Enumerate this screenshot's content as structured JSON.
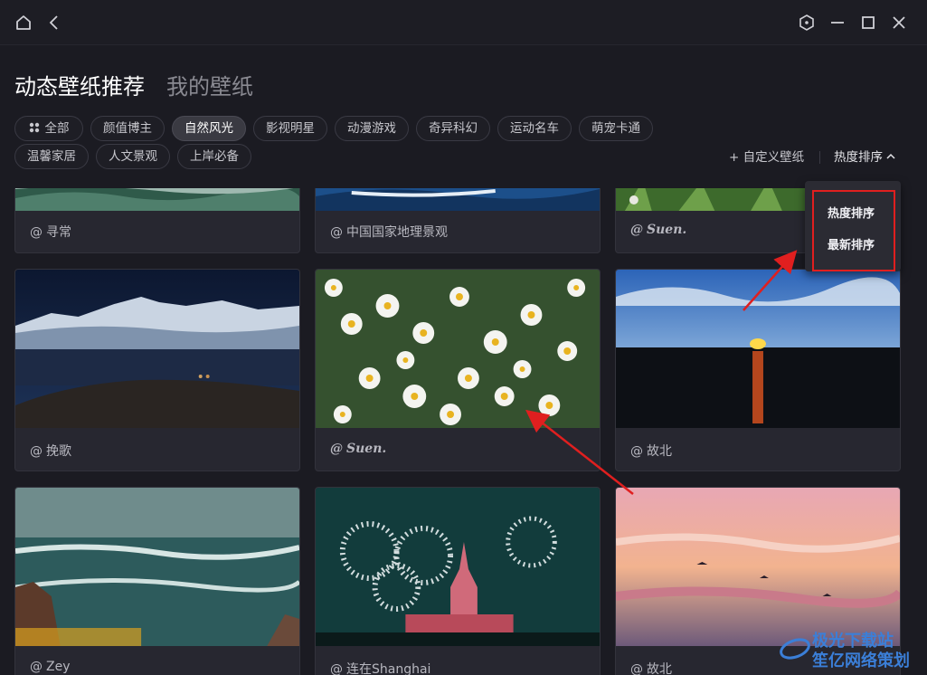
{
  "window": {
    "icons": [
      "home-icon",
      "back-icon",
      "shield-icon",
      "minimize-icon",
      "maximize-icon",
      "close-icon"
    ]
  },
  "header": {
    "tabs": [
      {
        "label": "动态壁纸推荐",
        "active": true
      },
      {
        "label": "我的壁纸",
        "active": false
      }
    ]
  },
  "categories": [
    {
      "label": "全部",
      "icon": "grid-icon",
      "active": false
    },
    {
      "label": "颜值博主",
      "active": false
    },
    {
      "label": "自然风光",
      "active": true
    },
    {
      "label": "影视明星",
      "active": false
    },
    {
      "label": "动漫游戏",
      "active": false
    },
    {
      "label": "奇异科幻",
      "active": false
    },
    {
      "label": "运动名车",
      "active": false
    },
    {
      "label": "萌宠卡通",
      "active": false
    },
    {
      "label": "温馨家居",
      "active": false
    },
    {
      "label": "人文景观",
      "active": false
    },
    {
      "label": "上岸必备",
      "active": false
    }
  ],
  "toolbar": {
    "custom_wallpaper": "+ 自定义壁纸",
    "sort_label": "热度排序"
  },
  "sort_dropdown": {
    "options": [
      "热度排序",
      "最新排序"
    ],
    "highlight_color": "#e01f1f"
  },
  "cards": [
    {
      "author": "寻常"
    },
    {
      "author": "中国国家地理景观"
    },
    {
      "author": "Suen."
    },
    {
      "author": "挽歌"
    },
    {
      "author": "Suen."
    },
    {
      "author": "故北"
    },
    {
      "author": "Zey"
    },
    {
      "author": "连在Shanghai"
    },
    {
      "author": "故北"
    }
  ],
  "author_prefix": "@",
  "watermark": {
    "line1": "极光下载站",
    "line2": "笙亿网络策划"
  },
  "colors": {
    "background": "#1b1b22",
    "card": "#272730",
    "annotation_red": "#e01f1f"
  }
}
